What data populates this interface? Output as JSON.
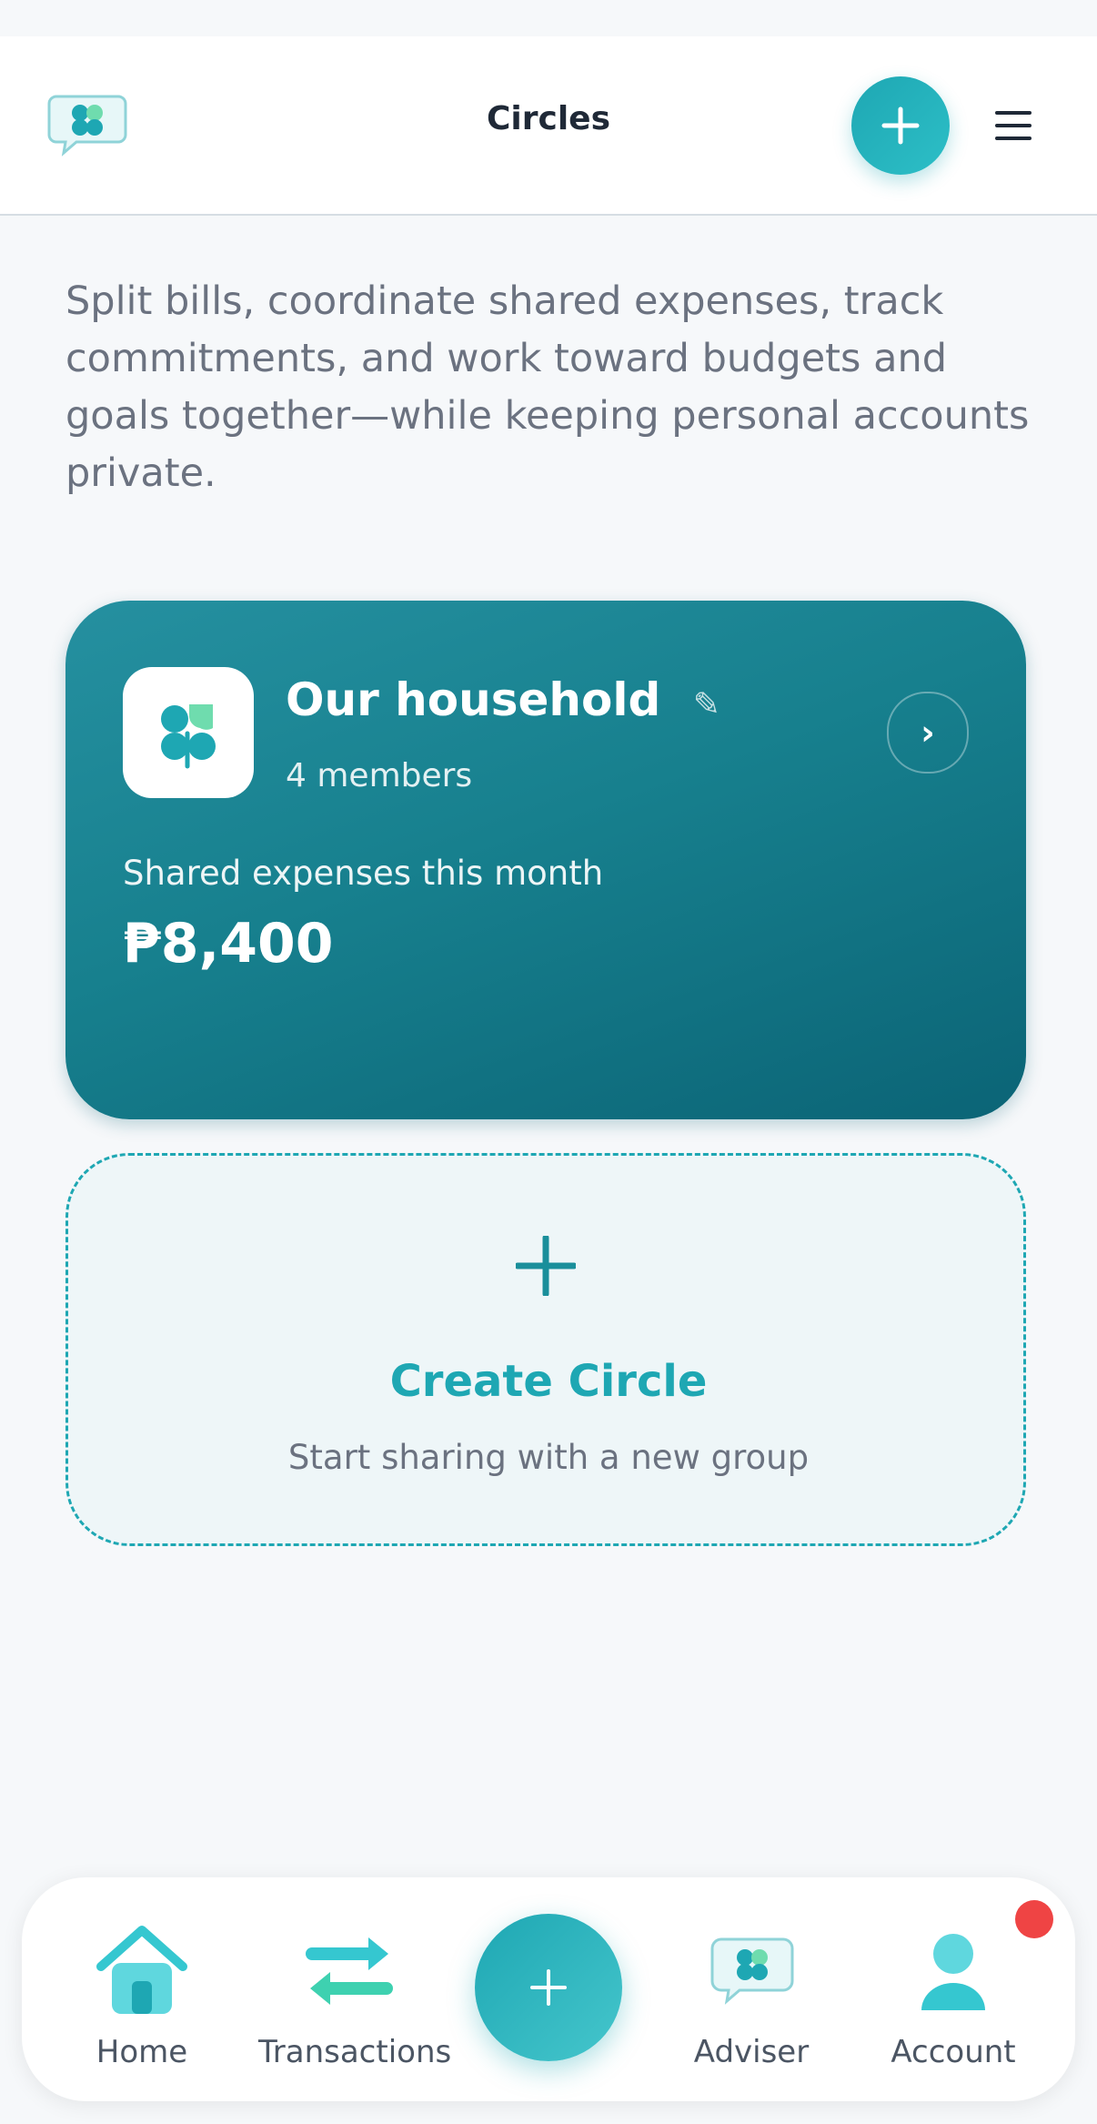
{
  "header": {
    "title": "Circles"
  },
  "intro": "Split bills, coordinate shared expenses, track commitments, and work toward budgets and goals together—while keeping personal accounts private.",
  "circle": {
    "name": "Our household",
    "members": "4 members",
    "shared_label": "Shared expenses this month",
    "shared_amount": "₱8,400",
    "chevron": "›",
    "edit_icon": "✎"
  },
  "create": {
    "title": "Create Circle",
    "subtitle": "Start sharing with a new group"
  },
  "nav": {
    "home": "Home",
    "transactions": "Transactions",
    "adviser": "Adviser",
    "account": "Account"
  },
  "colors": {
    "accent": "#1ea7b3",
    "card_dark": "#0b6476",
    "badge": "#ef4444"
  },
  "icons": [
    "clover-chat-logo-icon",
    "plus-icon",
    "hamburger-menu-icon",
    "clover-icon",
    "edit-icon",
    "chevron-right-icon",
    "home-icon",
    "transactions-icon",
    "adviser-icon",
    "account-icon"
  ]
}
